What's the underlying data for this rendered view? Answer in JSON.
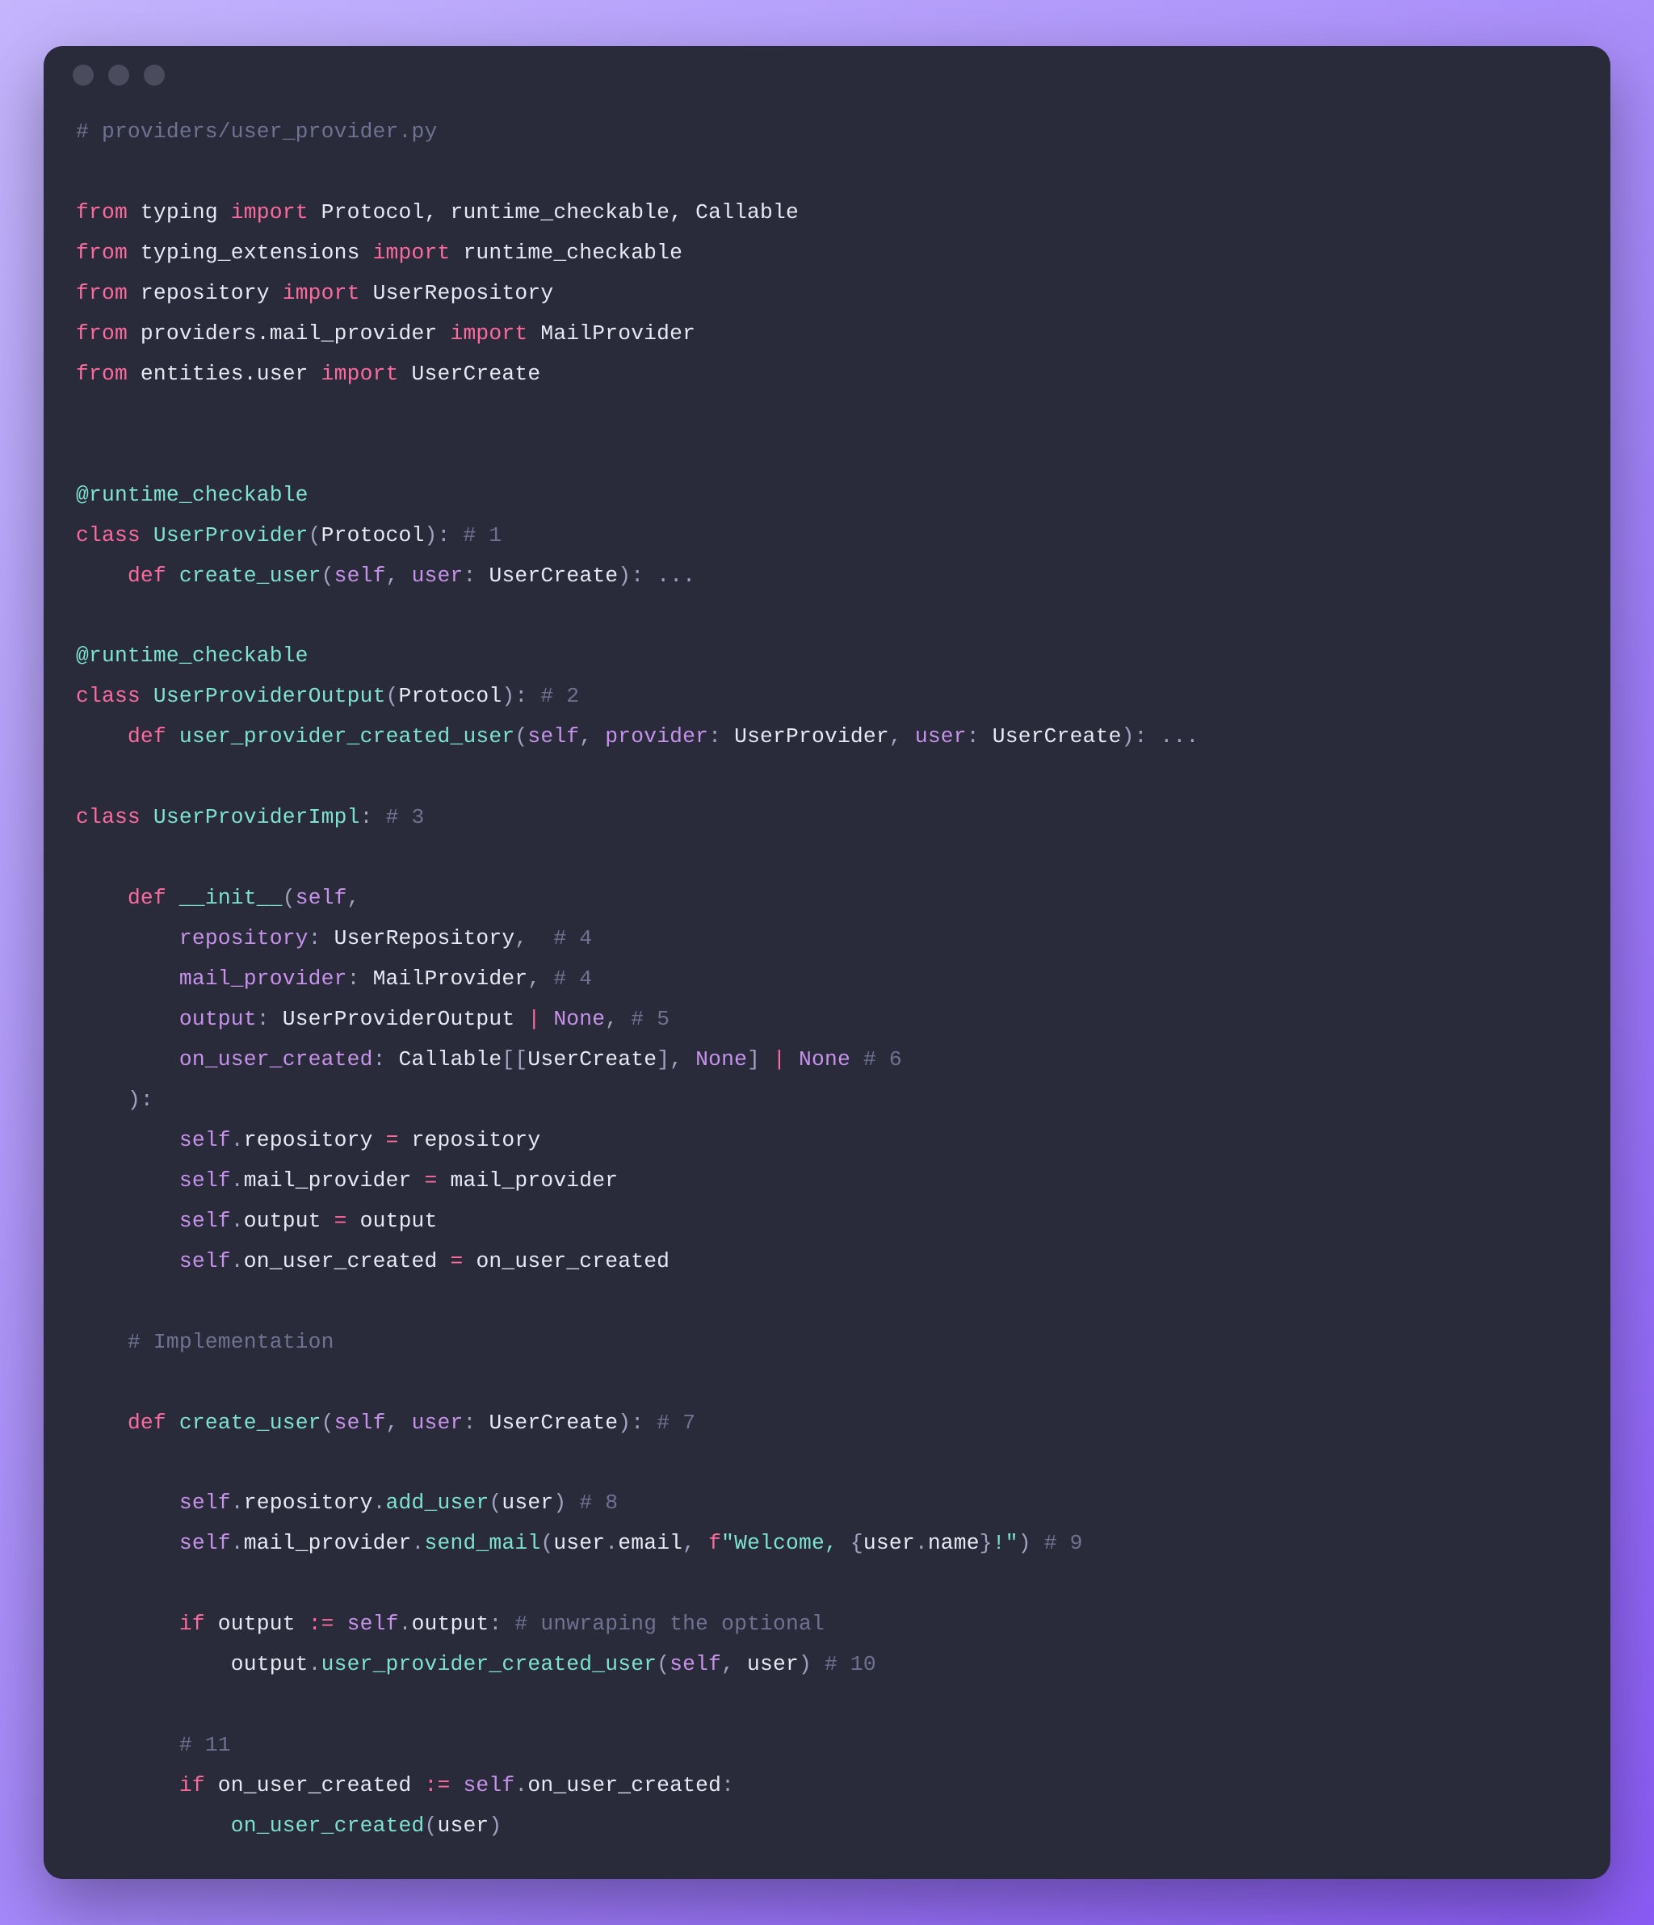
{
  "window": {
    "dots": 3
  },
  "code": {
    "tokens": [
      [
        [
          "c-comment",
          "# providers/user_provider.py"
        ]
      ],
      [],
      [
        [
          "c-kw",
          "from"
        ],
        [
          "",
          " typing "
        ],
        [
          "c-kw",
          "import"
        ],
        [
          "",
          " Protocol, runtime_checkable, Callable"
        ]
      ],
      [
        [
          "c-kw",
          "from"
        ],
        [
          "",
          " typing_extensions "
        ],
        [
          "c-kw",
          "import"
        ],
        [
          "",
          " runtime_checkable"
        ]
      ],
      [
        [
          "c-kw",
          "from"
        ],
        [
          "",
          " repository "
        ],
        [
          "c-kw",
          "import"
        ],
        [
          "",
          " UserRepository"
        ]
      ],
      [
        [
          "c-kw",
          "from"
        ],
        [
          "",
          " providers.mail_provider "
        ],
        [
          "c-kw",
          "import"
        ],
        [
          "",
          " MailProvider"
        ]
      ],
      [
        [
          "c-kw",
          "from"
        ],
        [
          "",
          " entities.user "
        ],
        [
          "c-kw",
          "import"
        ],
        [
          "",
          " UserCreate"
        ]
      ],
      [],
      [],
      [
        [
          "c-fn",
          "@runtime_checkable"
        ]
      ],
      [
        [
          "c-kw",
          "class"
        ],
        [
          "",
          " "
        ],
        [
          "c-fn",
          "UserProvider"
        ],
        [
          "c-punct",
          "("
        ],
        [
          "",
          "Protocol"
        ],
        [
          "c-punct",
          "):"
        ],
        [
          "",
          " "
        ],
        [
          "c-comment",
          "# 1"
        ]
      ],
      [
        [
          "",
          "    "
        ],
        [
          "c-kw",
          "def"
        ],
        [
          "",
          " "
        ],
        [
          "c-fn",
          "create_user"
        ],
        [
          "c-punct",
          "("
        ],
        [
          "c-self",
          "self"
        ],
        [
          "c-punct",
          ", "
        ],
        [
          "c-self",
          "user"
        ],
        [
          "c-punct",
          ": "
        ],
        [
          "",
          "UserCreate"
        ],
        [
          "c-punct",
          "): ..."
        ]
      ],
      [],
      [
        [
          "c-fn",
          "@runtime_checkable"
        ]
      ],
      [
        [
          "c-kw",
          "class"
        ],
        [
          "",
          " "
        ],
        [
          "c-fn",
          "UserProviderOutput"
        ],
        [
          "c-punct",
          "("
        ],
        [
          "",
          "Protocol"
        ],
        [
          "c-punct",
          "):"
        ],
        [
          "",
          " "
        ],
        [
          "c-comment",
          "# 2"
        ]
      ],
      [
        [
          "",
          "    "
        ],
        [
          "c-kw",
          "def"
        ],
        [
          "",
          " "
        ],
        [
          "c-fn",
          "user_provider_created_user"
        ],
        [
          "c-punct",
          "("
        ],
        [
          "c-self",
          "self"
        ],
        [
          "c-punct",
          ", "
        ],
        [
          "c-self",
          "provider"
        ],
        [
          "c-punct",
          ": "
        ],
        [
          "",
          "UserProvider"
        ],
        [
          "c-punct",
          ", "
        ],
        [
          "c-self",
          "user"
        ],
        [
          "c-punct",
          ": "
        ],
        [
          "",
          "UserCreate"
        ],
        [
          "c-punct",
          "): ..."
        ]
      ],
      [],
      [
        [
          "c-kw",
          "class"
        ],
        [
          "",
          " "
        ],
        [
          "c-fn",
          "UserProviderImpl"
        ],
        [
          "c-punct",
          ":"
        ],
        [
          "",
          " "
        ],
        [
          "c-comment",
          "# 3"
        ]
      ],
      [],
      [
        [
          "",
          "    "
        ],
        [
          "c-kw",
          "def"
        ],
        [
          "",
          " "
        ],
        [
          "c-fn",
          "__init__"
        ],
        [
          "c-punct",
          "("
        ],
        [
          "c-self",
          "self"
        ],
        [
          "c-punct",
          ","
        ]
      ],
      [
        [
          "",
          "        "
        ],
        [
          "c-self",
          "repository"
        ],
        [
          "c-punct",
          ": "
        ],
        [
          "",
          "UserRepository"
        ],
        [
          "c-punct",
          ",  "
        ],
        [
          "c-comment",
          "# 4"
        ]
      ],
      [
        [
          "",
          "        "
        ],
        [
          "c-self",
          "mail_provider"
        ],
        [
          "c-punct",
          ": "
        ],
        [
          "",
          "MailProvider"
        ],
        [
          "c-punct",
          ", "
        ],
        [
          "c-comment",
          "# 4"
        ]
      ],
      [
        [
          "",
          "        "
        ],
        [
          "c-self",
          "output"
        ],
        [
          "c-punct",
          ": "
        ],
        [
          "",
          "UserProviderOutput "
        ],
        [
          "c-op",
          "|"
        ],
        [
          "",
          " "
        ],
        [
          "c-none",
          "None"
        ],
        [
          "c-punct",
          ", "
        ],
        [
          "c-comment",
          "# 5"
        ]
      ],
      [
        [
          "",
          "        "
        ],
        [
          "c-self",
          "on_user_created"
        ],
        [
          "c-punct",
          ": "
        ],
        [
          "",
          "Callable"
        ],
        [
          "c-punct",
          "[["
        ],
        [
          "",
          "UserCreate"
        ],
        [
          "c-punct",
          "], "
        ],
        [
          "c-none",
          "None"
        ],
        [
          "c-punct",
          "] "
        ],
        [
          "c-op",
          "|"
        ],
        [
          "",
          " "
        ],
        [
          "c-none",
          "None"
        ],
        [
          "",
          " "
        ],
        [
          "c-comment",
          "# 6"
        ]
      ],
      [
        [
          "",
          "    "
        ],
        [
          "c-punct",
          "):"
        ]
      ],
      [
        [
          "",
          "        "
        ],
        [
          "c-self",
          "self"
        ],
        [
          "c-punct",
          "."
        ],
        [
          "",
          "repository "
        ],
        [
          "c-op",
          "="
        ],
        [
          "",
          " repository"
        ]
      ],
      [
        [
          "",
          "        "
        ],
        [
          "c-self",
          "self"
        ],
        [
          "c-punct",
          "."
        ],
        [
          "",
          "mail_provider "
        ],
        [
          "c-op",
          "="
        ],
        [
          "",
          " mail_provider"
        ]
      ],
      [
        [
          "",
          "        "
        ],
        [
          "c-self",
          "self"
        ],
        [
          "c-punct",
          "."
        ],
        [
          "",
          "output "
        ],
        [
          "c-op",
          "="
        ],
        [
          "",
          " output"
        ]
      ],
      [
        [
          "",
          "        "
        ],
        [
          "c-self",
          "self"
        ],
        [
          "c-punct",
          "."
        ],
        [
          "",
          "on_user_created "
        ],
        [
          "c-op",
          "="
        ],
        [
          "",
          " on_user_created"
        ]
      ],
      [],
      [
        [
          "",
          "    "
        ],
        [
          "c-comment",
          "# Implementation"
        ]
      ],
      [],
      [
        [
          "",
          "    "
        ],
        [
          "c-kw",
          "def"
        ],
        [
          "",
          " "
        ],
        [
          "c-fn",
          "create_user"
        ],
        [
          "c-punct",
          "("
        ],
        [
          "c-self",
          "self"
        ],
        [
          "c-punct",
          ", "
        ],
        [
          "c-self",
          "user"
        ],
        [
          "c-punct",
          ": "
        ],
        [
          "",
          "UserCreate"
        ],
        [
          "c-punct",
          "):"
        ],
        [
          "",
          " "
        ],
        [
          "c-comment",
          "# 7"
        ]
      ],
      [],
      [
        [
          "",
          "        "
        ],
        [
          "c-self",
          "self"
        ],
        [
          "c-punct",
          "."
        ],
        [
          "",
          "repository"
        ],
        [
          "c-punct",
          "."
        ],
        [
          "c-fn",
          "add_user"
        ],
        [
          "c-punct",
          "("
        ],
        [
          "",
          "user"
        ],
        [
          "c-punct",
          ") "
        ],
        [
          "c-comment",
          "# 8"
        ]
      ],
      [
        [
          "",
          "        "
        ],
        [
          "c-self",
          "self"
        ],
        [
          "c-punct",
          "."
        ],
        [
          "",
          "mail_provider"
        ],
        [
          "c-punct",
          "."
        ],
        [
          "c-fn",
          "send_mail"
        ],
        [
          "c-punct",
          "("
        ],
        [
          "",
          "user"
        ],
        [
          "c-punct",
          "."
        ],
        [
          "",
          "email"
        ],
        [
          "c-punct",
          ", "
        ],
        [
          "c-kw",
          "f"
        ],
        [
          "c-str",
          "\"Welcome, "
        ],
        [
          "c-punct",
          "{"
        ],
        [
          "",
          "user"
        ],
        [
          "c-punct",
          "."
        ],
        [
          "",
          "name"
        ],
        [
          "c-punct",
          "}"
        ],
        [
          "c-str",
          "!\""
        ],
        [
          "c-punct",
          ") "
        ],
        [
          "c-comment",
          "# 9"
        ]
      ],
      [],
      [
        [
          "",
          "        "
        ],
        [
          "c-kw",
          "if"
        ],
        [
          "",
          " output "
        ],
        [
          "c-op",
          ":="
        ],
        [
          "",
          " "
        ],
        [
          "c-self",
          "self"
        ],
        [
          "c-punct",
          "."
        ],
        [
          "",
          "output"
        ],
        [
          "c-punct",
          ":"
        ],
        [
          "",
          " "
        ],
        [
          "c-comment",
          "# unwraping the optional"
        ]
      ],
      [
        [
          "",
          "            "
        ],
        [
          "",
          "output"
        ],
        [
          "c-punct",
          "."
        ],
        [
          "c-fn",
          "user_provider_created_user"
        ],
        [
          "c-punct",
          "("
        ],
        [
          "c-self",
          "self"
        ],
        [
          "c-punct",
          ", "
        ],
        [
          "",
          "user"
        ],
        [
          "c-punct",
          ") "
        ],
        [
          "c-comment",
          "# 10"
        ]
      ],
      [],
      [
        [
          "",
          "        "
        ],
        [
          "c-comment",
          "# 11"
        ]
      ],
      [
        [
          "",
          "        "
        ],
        [
          "c-kw",
          "if"
        ],
        [
          "",
          " on_user_created "
        ],
        [
          "c-op",
          ":="
        ],
        [
          "",
          " "
        ],
        [
          "c-self",
          "self"
        ],
        [
          "c-punct",
          "."
        ],
        [
          "",
          "on_user_created"
        ],
        [
          "c-punct",
          ":"
        ]
      ],
      [
        [
          "",
          "            "
        ],
        [
          "c-fn",
          "on_user_created"
        ],
        [
          "c-punct",
          "("
        ],
        [
          "",
          "user"
        ],
        [
          "c-punct",
          ")"
        ]
      ]
    ]
  }
}
